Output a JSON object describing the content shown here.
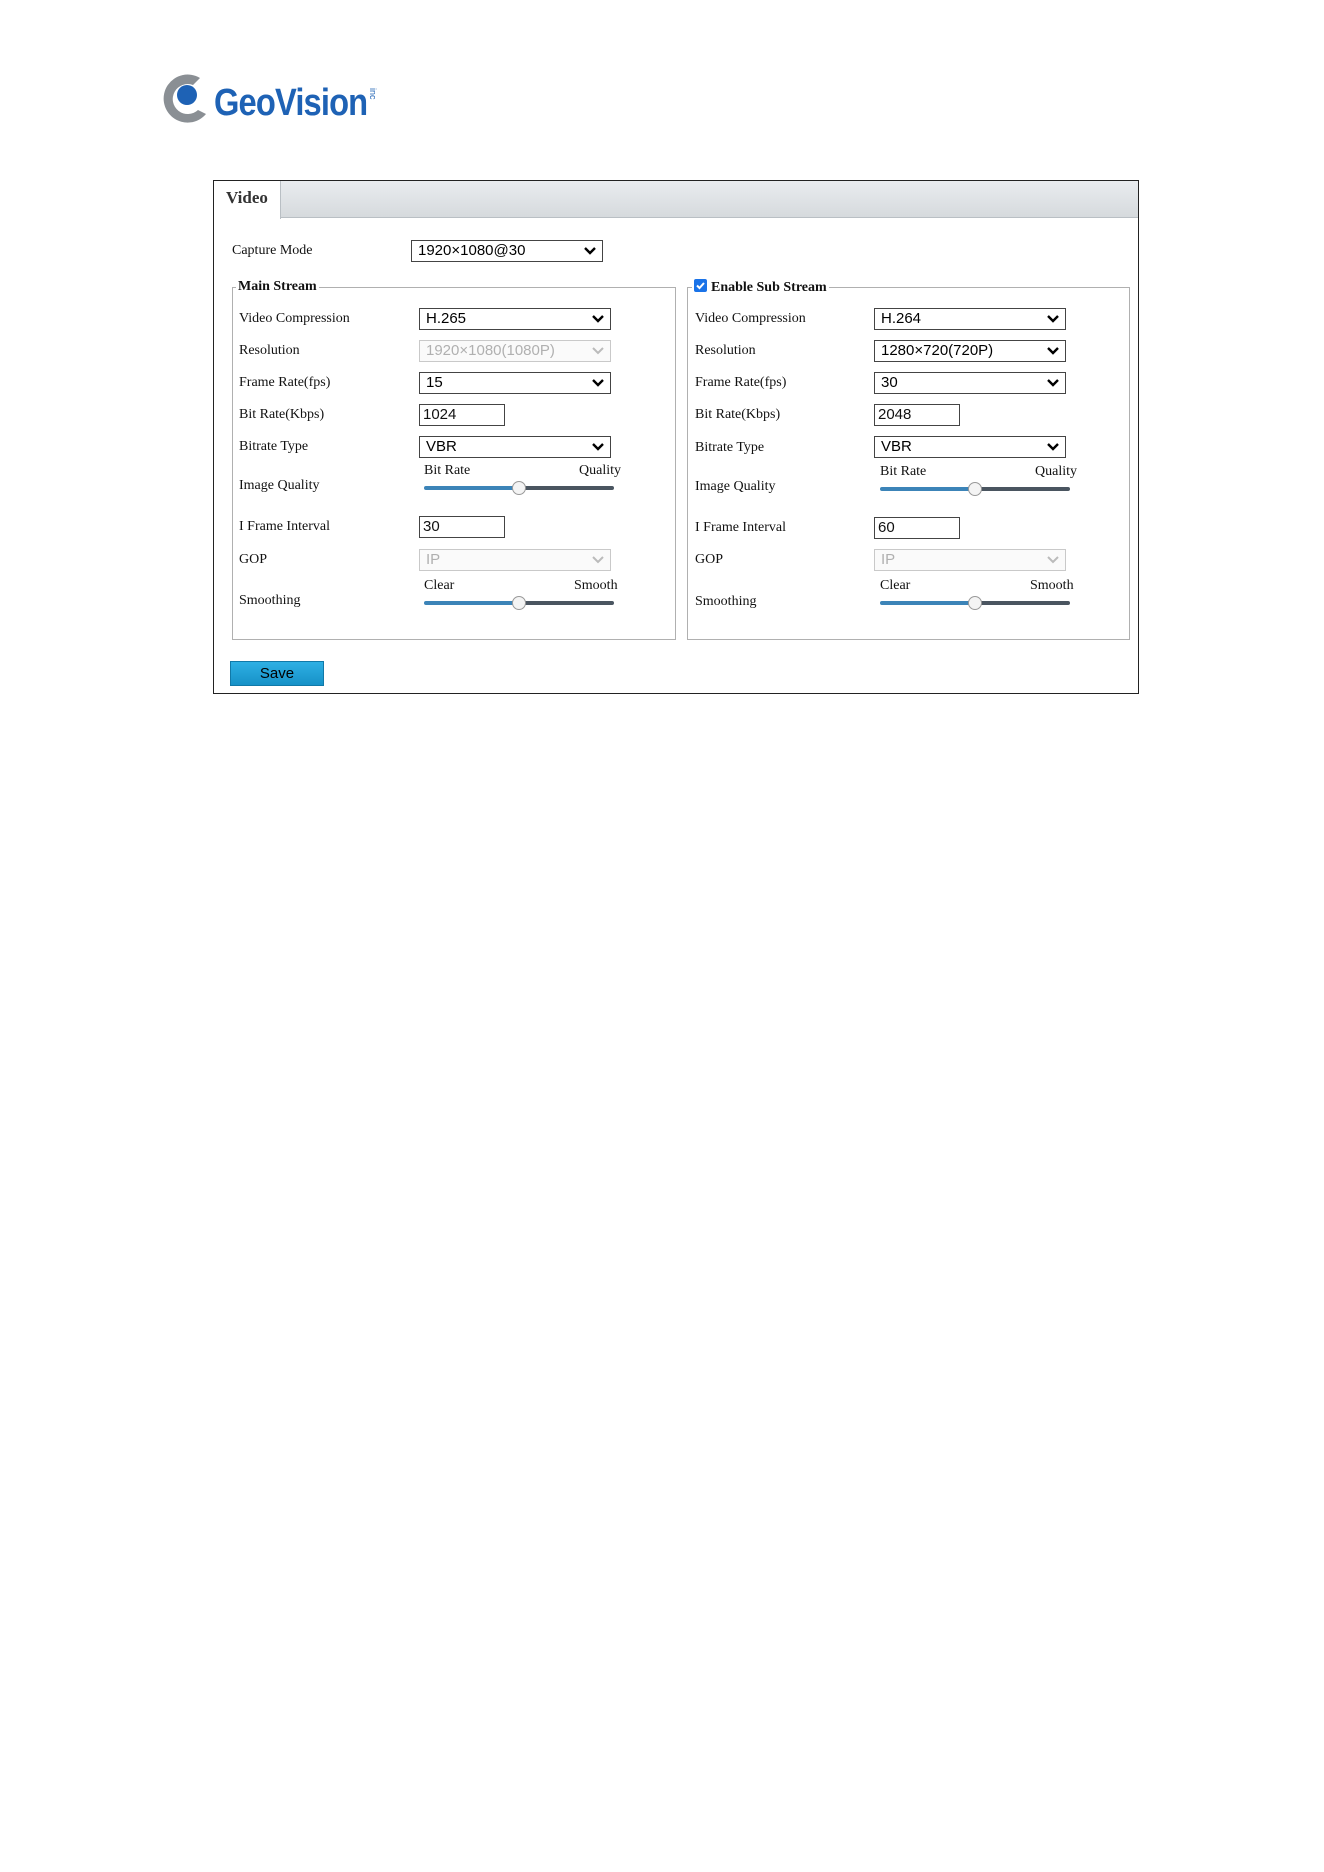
{
  "brand": {
    "name": "GeoVision",
    "inc": "inc"
  },
  "tab": {
    "label": "Video"
  },
  "capture_mode": {
    "label": "Capture Mode",
    "value": "1920×1080@30"
  },
  "main_stream": {
    "title": "Main Stream",
    "video_compression": {
      "label": "Video Compression",
      "value": "H.265"
    },
    "resolution": {
      "label": "Resolution",
      "value": "1920×1080(1080P)"
    },
    "frame_rate": {
      "label": "Frame Rate(fps)",
      "value": "15"
    },
    "bit_rate": {
      "label": "Bit Rate(Kbps)",
      "value": "1024"
    },
    "bitrate_type": {
      "label": "Bitrate Type",
      "value": "VBR"
    },
    "image_quality": {
      "label": "Image Quality",
      "left": "Bit Rate",
      "right": "Quality",
      "level": 0.5
    },
    "i_frame_interval": {
      "label": "I Frame Interval",
      "value": "30"
    },
    "gop": {
      "label": "GOP",
      "value": "IP"
    },
    "smoothing": {
      "label": "Smoothing",
      "left": "Clear",
      "right": "Smooth",
      "level": 0.5
    }
  },
  "sub_stream": {
    "title": "Enable Sub Stream",
    "enabled": true,
    "video_compression": {
      "label": "Video Compression",
      "value": "H.264"
    },
    "resolution": {
      "label": "Resolution",
      "value": "1280×720(720P)"
    },
    "frame_rate": {
      "label": "Frame Rate(fps)",
      "value": "30"
    },
    "bit_rate": {
      "label": "Bit Rate(Kbps)",
      "value": "2048"
    },
    "bitrate_type": {
      "label": "Bitrate Type",
      "value": "VBR"
    },
    "image_quality": {
      "label": "Image Quality",
      "left": "Bit Rate",
      "right": "Quality",
      "level": 0.5
    },
    "i_frame_interval": {
      "label": "I Frame Interval",
      "value": "60"
    },
    "gop": {
      "label": "GOP",
      "value": "IP"
    },
    "smoothing": {
      "label": "Smoothing",
      "left": "Clear",
      "right": "Smooth",
      "level": 0.5
    }
  },
  "save_button": {
    "label": "Save"
  },
  "colors": {
    "brand_blue": "#1e62b5",
    "save_button": "#1fa0d8",
    "slider_fill": "#3c84b8",
    "slider_track": "#4a5560",
    "checkbox": "#1a73e8"
  }
}
